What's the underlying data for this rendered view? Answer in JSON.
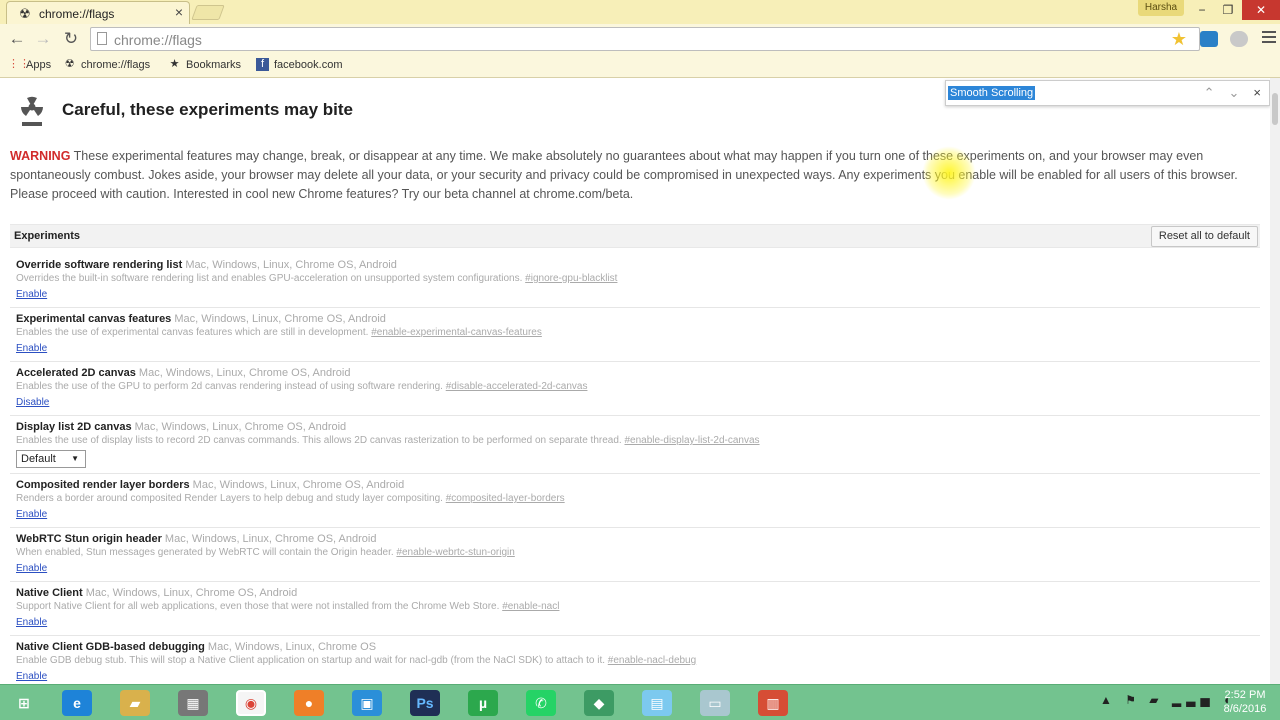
{
  "browser": {
    "tab_title": "chrome://flags",
    "user_name": "Harsha",
    "address": "chrome://flags",
    "bookmarks": [
      {
        "label": "Apps",
        "icon": "apps-grid-icon"
      },
      {
        "label": "chrome://flags",
        "icon": "radiation-icon"
      },
      {
        "label": "Bookmarks",
        "icon": "star-icon"
      },
      {
        "label": "facebook.com",
        "icon": "facebook-icon"
      }
    ]
  },
  "find": {
    "query": "Smooth Scrolling"
  },
  "page": {
    "heading": "Careful, these experiments may bite",
    "warning_label": "WARNING",
    "warning_text": "These experimental features may change, break, or disappear at any time. We make absolutely no guarantees about what may happen if you turn one of these experiments on, and your browser may even spontaneously combust. Jokes aside, your browser may delete all your data, or your security and privacy could be compromised in unexpected ways. Any experiments you enable will be enabled for all users of this browser. Please proceed with caution. Interested in cool new Chrome features? Try our beta channel at chrome.com/beta.",
    "experiments_title": "Experiments",
    "reset_label": "Reset all to default",
    "experiments": [
      {
        "name": "Override software rendering list",
        "platforms": "Mac, Windows, Linux, Chrome OS, Android",
        "description": "Overrides the built-in software rendering list and enables GPU-acceleration on unsupported system configurations.",
        "tag": "#ignore-gpu-blacklist",
        "action": "Enable"
      },
      {
        "name": "Experimental canvas features",
        "platforms": "Mac, Windows, Linux, Chrome OS, Android",
        "description": "Enables the use of experimental canvas features which are still in development.",
        "tag": "#enable-experimental-canvas-features",
        "action": "Enable"
      },
      {
        "name": "Accelerated 2D canvas",
        "platforms": "Mac, Windows, Linux, Chrome OS, Android",
        "description": "Enables the use of the GPU to perform 2d canvas rendering instead of using software rendering.",
        "tag": "#disable-accelerated-2d-canvas",
        "action": "Disable"
      },
      {
        "name": "Display list 2D canvas",
        "platforms": "Mac, Windows, Linux, Chrome OS, Android",
        "description": "Enables the use of display lists to record 2D canvas commands. This allows 2D canvas rasterization to be performed on separate thread.",
        "tag": "#enable-display-list-2d-canvas",
        "action": "Default"
      },
      {
        "name": "Composited render layer borders",
        "platforms": "Mac, Windows, Linux, Chrome OS, Android",
        "description": "Renders a border around composited Render Layers to help debug and study layer compositing.",
        "tag": "#composited-layer-borders",
        "action": "Enable"
      },
      {
        "name": "WebRTC Stun origin header",
        "platforms": "Mac, Windows, Linux, Chrome OS, Android",
        "description": "When enabled, Stun messages generated by WebRTC will contain the Origin header.",
        "tag": "#enable-webrtc-stun-origin",
        "action": "Enable"
      },
      {
        "name": "Native Client",
        "platforms": "Mac, Windows, Linux, Chrome OS, Android",
        "description": "Support Native Client for all web applications, even those that were not installed from the Chrome Web Store.",
        "tag": "#enable-nacl",
        "action": "Enable"
      },
      {
        "name": "Native Client GDB-based debugging",
        "platforms": "Mac, Windows, Linux, Chrome OS",
        "description": "Enable GDB debug stub. This will stop a Native Client application on startup and wait for nacl-gdb (from the NaCl SDK) to attach to it.",
        "tag": "#enable-nacl-debug",
        "action": "Enable"
      }
    ]
  },
  "taskbar": {
    "time": "2:52 PM",
    "date": "8/6/2016"
  }
}
